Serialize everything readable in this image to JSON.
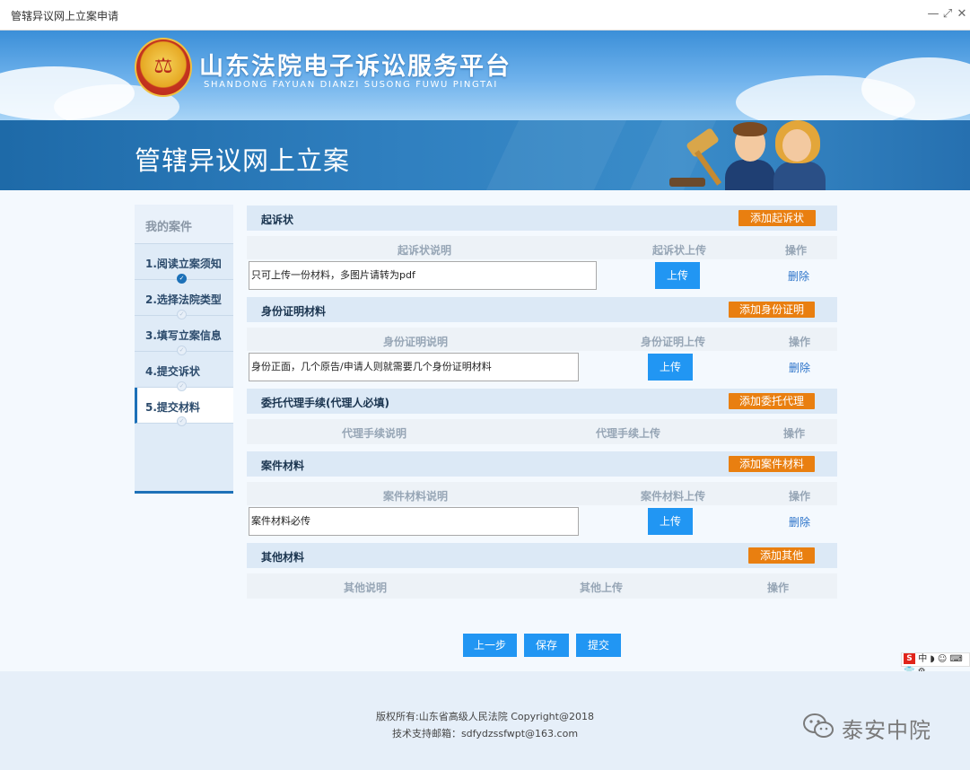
{
  "window": {
    "title": "管辖异议网上立案申请",
    "minimize": "—",
    "maximize": "⤢",
    "close": "✕"
  },
  "site": {
    "name_cn": "山东法院电子诉讼服务平台",
    "name_en": "SHANDONG FAYUAN DIANZI SUSONG FUWU PINGTAI"
  },
  "page": {
    "heading": "管辖异议网上立案"
  },
  "sidebar": {
    "header": "我的案件",
    "steps": [
      {
        "label": "1.阅读立案须知",
        "done": true
      },
      {
        "label": "2.选择法院类型",
        "done": false
      },
      {
        "label": "3.填写立案信息",
        "done": false
      },
      {
        "label": "4.提交诉状",
        "done": false
      },
      {
        "label": "5.提交材料",
        "done": false,
        "active": true
      }
    ]
  },
  "sections": {
    "complaint": {
      "title": "起诉状",
      "add_label": "添加起诉状",
      "col_desc": "起诉状说明",
      "col_upload": "起诉状上传",
      "col_action": "操作",
      "row": {
        "desc": "只可上传一份材料，多图片请转为pdf",
        "upload": "上传",
        "delete": "删除"
      }
    },
    "identity": {
      "title": "身份证明材料",
      "add_label": "添加身份证明",
      "col_desc": "身份证明说明",
      "col_upload": "身份证明上传",
      "col_action": "操作",
      "row": {
        "desc": "身份正面，几个原告/申请人则就需要几个身份证明材料",
        "upload": "上传",
        "delete": "删除"
      }
    },
    "agent": {
      "title": "委托代理手续(代理人必填)",
      "add_label": "添加委托代理",
      "col_desc": "代理手续说明",
      "col_upload": "代理手续上传",
      "col_action": "操作"
    },
    "case": {
      "title": "案件材料",
      "add_label": "添加案件材料",
      "col_desc": "案件材料说明",
      "col_upload": "案件材料上传",
      "col_action": "操作",
      "row": {
        "desc": "案件材料必传",
        "upload": "上传",
        "delete": "删除"
      }
    },
    "other": {
      "title": "其他材料",
      "add_label": "添加其他",
      "col_desc": "其他说明",
      "col_upload": "其他上传",
      "col_action": "操作"
    }
  },
  "actions": {
    "prev": "上一步",
    "save": "保存",
    "submit": "提交"
  },
  "ime": {
    "logo": "S",
    "text": "中 ◗ ☺ ⌨ 👕 ⚙"
  },
  "footer": {
    "copyright": "版权所有:山东省高级人民法院 Copyright@2018",
    "email": "技术支持邮箱：sdfydzssfwpt@163.com"
  },
  "watermark": {
    "text": "泰安中院"
  },
  "colors": {
    "primary": "#2196f3",
    "accent_orange": "#e97f10",
    "nav_blue": "#1d71b8",
    "delete_link": "#2a72c9"
  },
  "icons": [
    "court-emblem-icon",
    "check-icon",
    "wechat-icon",
    "gavel-icon"
  ]
}
